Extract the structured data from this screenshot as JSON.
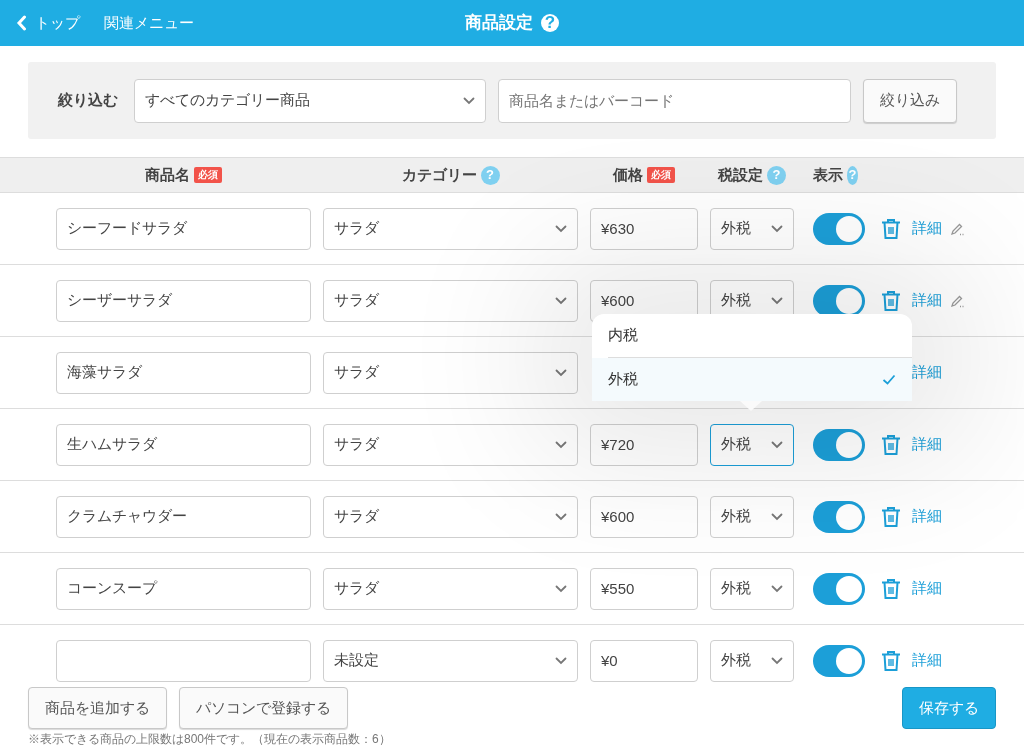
{
  "header": {
    "back_link": "トップ",
    "menu_link": "関連メニュー",
    "title": "商品設定",
    "help": "?"
  },
  "filter": {
    "label": "絞り込む",
    "category": "すべてのカテゴリー商品",
    "placeholder": "商品名またはバーコード",
    "button": "絞り込み"
  },
  "columns": [
    {
      "label": "商品名",
      "required": "必須"
    },
    {
      "label": "カテゴリー",
      "help": "?"
    },
    {
      "label": "価格",
      "required": "必須"
    },
    {
      "label": "税設定",
      "help": "?"
    },
    {
      "label": "表示",
      "help": "?"
    }
  ],
  "rows": [
    {
      "name": "シーフードサラダ",
      "category": "サラダ",
      "price": "¥630",
      "tax": "外税",
      "focused": false,
      "shown": true,
      "detail": "詳細",
      "edited": true
    },
    {
      "name": "シーザーサラダ",
      "category": "サラダ",
      "price": "¥600",
      "tax": "外税",
      "focused": false,
      "shown": true,
      "detail": "詳細",
      "edited": true
    },
    {
      "name": "海藻サラダ",
      "category": "サラダ",
      "detail": "詳細",
      "edited": false
    },
    {
      "name": "生ハムサラダ",
      "category": "サラダ",
      "price": "¥720",
      "tax": "外税",
      "focused": true,
      "shown": true,
      "detail": "詳細",
      "edited": false
    },
    {
      "name": "クラムチャウダー",
      "category": "サラダ",
      "price": "¥600",
      "tax": "外税",
      "focused": false,
      "shown": true,
      "detail": "詳細",
      "edited": false
    },
    {
      "name": "コーンスープ",
      "category": "サラダ",
      "price": "¥550",
      "tax": "外税",
      "focused": false,
      "shown": true,
      "detail": "詳細",
      "edited": false
    },
    {
      "category": "未設定",
      "price": "¥0",
      "tax": "外税",
      "focused": false,
      "shown": true,
      "detail": "詳細",
      "edited": false
    }
  ],
  "tax_menu": {
    "options": [
      {
        "label": "内税",
        "selected": false
      },
      {
        "label": "外税",
        "selected": true
      }
    ]
  },
  "footer": {
    "buttons": [
      "商品を追加する",
      "パソコンで登録する"
    ],
    "save": "保存する",
    "note": "※表示できる商品の上限数は800件です。（現在の表示商品数：6）"
  }
}
